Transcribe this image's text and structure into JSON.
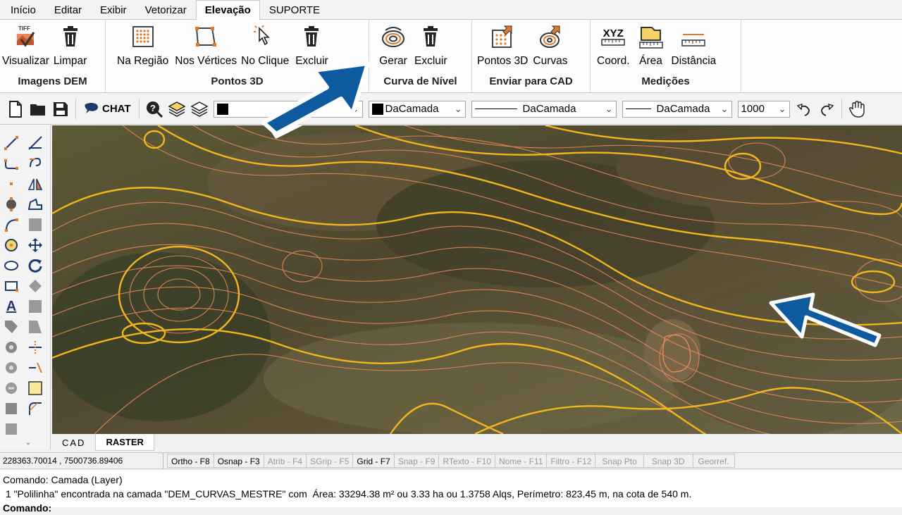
{
  "ribbon_tabs": [
    {
      "label": "Início"
    },
    {
      "label": "Editar"
    },
    {
      "label": "Exibir"
    },
    {
      "label": "Vetorizar"
    },
    {
      "label": "Elevação"
    },
    {
      "label": "SUPORTE"
    }
  ],
  "active_tab": "Elevação",
  "groups": {
    "imagens_dem": {
      "title": "Imagens DEM",
      "buttons": [
        "Visualizar",
        "Limpar"
      ]
    },
    "pontos_3d": {
      "title": "Pontos 3D",
      "buttons": [
        "Na Região",
        "Nos Vértices",
        "No Clique",
        "Excluir"
      ]
    },
    "curva_nivel": {
      "title": "Curva de Nível",
      "buttons": [
        "Gerar",
        "Excluir"
      ]
    },
    "enviar_cad": {
      "title": "Enviar para CAD",
      "buttons": [
        "Pontos 3D",
        "Curvas"
      ]
    },
    "medicoes": {
      "title": "Medições",
      "buttons": [
        "Coord.",
        "Área",
        "Distância"
      ],
      "xyz_icon_text": "XYZ"
    }
  },
  "toolbar": {
    "chat_label": "CHAT",
    "layer_combo": "",
    "color_combo": "DaCamada",
    "linetype_combo": "DaCamada",
    "lineweight_combo": "DaCamada",
    "scale_combo": "1000"
  },
  "canvas_tabs": [
    "CAD",
    "RASTER"
  ],
  "active_canvas_tab": "RASTER",
  "status": {
    "coords": "228363.70014 , 7500736.89406",
    "buttons": [
      {
        "label": "Ortho - F8",
        "on": true
      },
      {
        "label": "Osnap - F3",
        "on": true
      },
      {
        "label": "Atrib - F4",
        "on": false
      },
      {
        "label": "SGrip - F5",
        "on": false
      },
      {
        "label": "Grid - F7",
        "on": true
      },
      {
        "label": "Snap - F9",
        "on": false
      },
      {
        "label": "RTexto - F10",
        "on": false
      },
      {
        "label": "Nome - F11",
        "on": false
      },
      {
        "label": "Filtro - F12",
        "on": false
      },
      {
        "label": "Snap Pto",
        "on": false
      },
      {
        "label": "Snap 3D",
        "on": false
      },
      {
        "label": "Georref.",
        "on": false
      }
    ]
  },
  "command": {
    "line1": "Comando: Camada (Layer)",
    "line2": " 1 \"Polilinha\" encontrada na camada \"DEM_CURVAS_MESTRE\" com  Área: 33294.38 m² ou 3.33 ha ou 1.3758 Alqs, Perímetro: 823.45 m, na cota de 540 m.",
    "line3": "Comando:"
  },
  "colors": {
    "contour_major": "#f2b51e",
    "contour_minor": "#e8875a",
    "arrow_blue": "#0d5a9e",
    "accent_orange": "#e07a2b"
  }
}
